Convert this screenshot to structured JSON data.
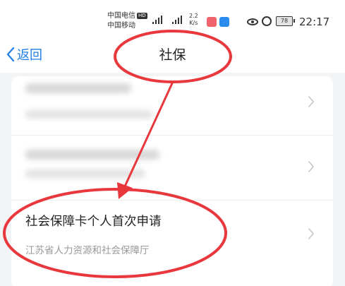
{
  "status_bar": {
    "carrier_1": "中国电信",
    "carrier_1_badge": "HD",
    "carrier_2": "中国移动",
    "net_speed_value": "2.2",
    "net_speed_unit": "K/s",
    "battery_level": "78",
    "time": "22:17"
  },
  "header": {
    "back_label": "返回",
    "title": "社保"
  },
  "list": {
    "items": [
      {
        "title": "",
        "subtitle": "",
        "blurred": true
      },
      {
        "title": "",
        "subtitle": "",
        "blurred": true
      },
      {
        "title": "社会保障卡个人首次申请",
        "subtitle": "江苏省人力资源和社会保障厅",
        "blurred": false
      }
    ]
  },
  "colors": {
    "accent": "#1f7ee8",
    "annotation": "#e8383d",
    "background": "#f3f4f6"
  },
  "icons": [
    "chevron-left-icon",
    "chevron-right-icon",
    "eye-icon",
    "alarm-icon",
    "battery-icon",
    "signal-icon"
  ]
}
